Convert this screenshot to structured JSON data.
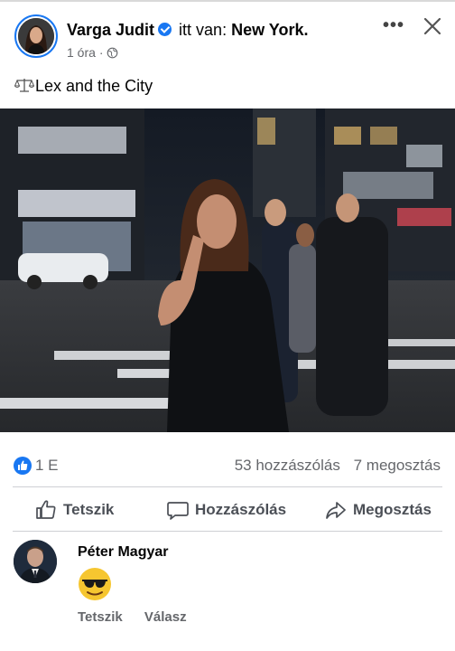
{
  "post": {
    "author": "Varga Judit",
    "checkin_prefix": "itt van:",
    "checkin_place": "New York.",
    "time": "1 óra",
    "separator": "·",
    "text": "Lex and the City"
  },
  "stats": {
    "likes": "1 E",
    "comments": "53 hozzászólás",
    "shares": "7 megosztás"
  },
  "actions": {
    "like": "Tetszik",
    "comment": "Hozzászólás",
    "share": "Megosztás"
  },
  "comment": {
    "author": "Péter Magyar",
    "emoji": "smiling-face-with-sunglasses",
    "like_label": "Tetszik",
    "reply_label": "Válasz"
  },
  "colors": {
    "accent": "#1877f2",
    "secondary_text": "#65676b",
    "divider": "#ced0d4"
  },
  "icons": [
    "verified-badge-icon",
    "globe-icon",
    "more-options-icon",
    "close-icon",
    "scales-icon",
    "like-reaction-icon",
    "thumbs-up-icon",
    "comment-bubble-icon",
    "share-arrow-icon"
  ]
}
